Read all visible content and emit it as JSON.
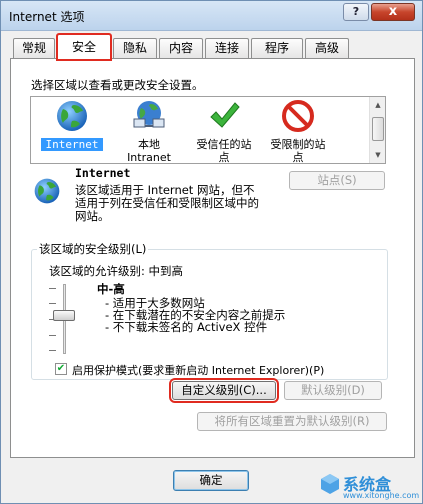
{
  "window": {
    "title": "Internet 选项",
    "help_glyph": "?",
    "close_glyph": "x"
  },
  "tabs": [
    {
      "label": "常规",
      "active": false
    },
    {
      "label": "安全",
      "active": true
    },
    {
      "label": "隐私",
      "active": false
    },
    {
      "label": "内容",
      "active": false
    },
    {
      "label": "连接",
      "active": false
    },
    {
      "label": "程序",
      "active": false
    },
    {
      "label": "高级",
      "active": false
    }
  ],
  "security": {
    "select_zone_prompt": "选择区域以查看或更改安全设置。",
    "zones": [
      {
        "label": "Internet",
        "icon": "globe-icon",
        "selected": true
      },
      {
        "label": "本地\nIntranet",
        "icon": "intranet-icon",
        "selected": false
      },
      {
        "label": "受信任的站\n点",
        "icon": "trusted-check-icon",
        "selected": false
      },
      {
        "label": "受限制的站\n点",
        "icon": "restricted-icon",
        "selected": false
      }
    ],
    "zone_detail": {
      "name": "Internet",
      "description": "该区域适用于 Internet 网站，但不适用于列在受信任和受限制区域中的网站。",
      "sites_button": "站点(S)"
    },
    "level_group": {
      "title": "该区域的安全级别(L)",
      "allowed_levels": "该区域的允许级别: 中到高",
      "level_name": "中-高",
      "bullets": [
        "- 适用于大多数网站",
        "- 在下载潜在的不安全内容之前提示",
        "- 不下载未签名的 ActiveX 控件"
      ],
      "slider_level": 0.4
    },
    "protected_mode": {
      "label": "启用保护模式(要求重新启动 Internet Explorer)(P)",
      "checked": true
    },
    "custom_level_button": "自定义级别(C)...",
    "default_level_button": "默认级别(D)",
    "reset_all_button": "将所有区域重置为默认级别(R)"
  },
  "footer": {
    "ok_button": "确定"
  },
  "watermark": {
    "brand": "系统盒",
    "url": "www.xitonghe.com"
  },
  "colors": {
    "highlight_outline": "#e02b20",
    "selection": "#3399ff",
    "close_button": "#c7452c"
  }
}
